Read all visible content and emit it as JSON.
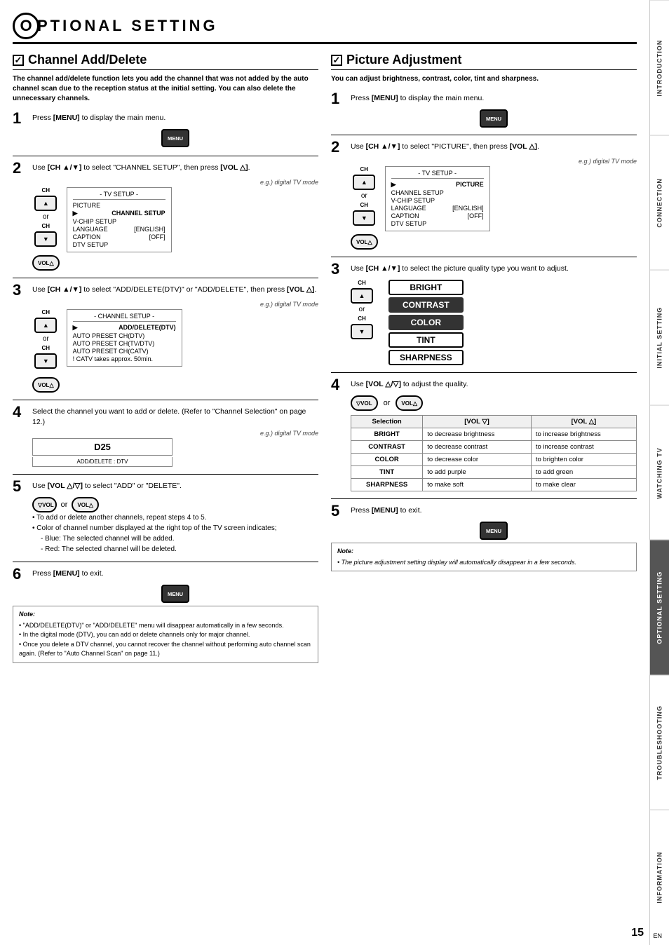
{
  "header": {
    "circle_letter": "O",
    "title": "PTIONAL   SETTING"
  },
  "sidebar_tabs": [
    {
      "label": "INTRODUCTION",
      "active": false
    },
    {
      "label": "CONNECTION",
      "active": false
    },
    {
      "label": "INITIAL SETTING",
      "active": false
    },
    {
      "label": "WATCHING TV",
      "active": false
    },
    {
      "label": "OPTIONAL SETTING",
      "active": true
    },
    {
      "label": "TROUBLESHOOTING",
      "active": false
    },
    {
      "label": "INFORMATION",
      "active": false
    }
  ],
  "channel_section": {
    "heading": "Channel Add/Delete",
    "description": "The channel add/delete function lets you add the channel that was not added by the auto channel scan due to the reception status at the initial setting. You can also delete the unnecessary channels.",
    "steps": [
      {
        "num": "1",
        "text": "Press [MENU] to display the main menu.",
        "has_menu_btn": true
      },
      {
        "num": "2",
        "text": "Use [CH ▲/▼] to select \"CHANNEL SETUP\", then press [VOL △].",
        "eg_label": "e.g.) digital TV mode",
        "tv_setup": {
          "title": "- TV SETUP -",
          "items": [
            "PICTURE",
            "CHANNEL SETUP",
            "V-CHIP  SETUP",
            "LANGUAGE    [ENGLISH]",
            "CAPTION     [OFF]",
            "DTV SETUP"
          ],
          "selected_index": 1
        }
      },
      {
        "num": "3",
        "text": "Use [CH ▲/▼] to select \"ADD/DELETE(DTV)\" or \"ADD/DELETE\", then press [VOL △].",
        "eg_label": "e.g.) digital TV mode",
        "channel_setup": {
          "title": "- CHANNEL SETUP -",
          "items": [
            "ADD/DELETE(DTV)",
            "AUTO PRESET CH(DTV)",
            "AUTO PRESET CH(TV/DTV)",
            "AUTO PRESET CH(CATV)",
            "! CATV takes approx. 50min."
          ],
          "selected_index": 0
        }
      },
      {
        "num": "4",
        "text": "Select the channel you want to add or delete. (Refer to \"Channel Selection\" on page 12.)",
        "eg_label": "e.g.) digital TV mode",
        "d25_label": "D25",
        "add_delete_label": "ADD/DELETE : DTV"
      },
      {
        "num": "5",
        "text": "Use [VOL △/▽] to select \"ADD\" or \"DELETE\".",
        "bullets": [
          "To add or delete another channels, repeat steps 4 to 5.",
          "Color of channel number displayed at the right top of the TV screen indicates;"
        ],
        "indent_bullets": [
          "Blue: The selected channel will be added.",
          "Red: The selected channel will be deleted."
        ]
      },
      {
        "num": "6",
        "text": "Press [MENU] to exit.",
        "has_menu_btn": true,
        "note": {
          "title": "Note:",
          "items": [
            "\"ADD/DELETE(DTV)\" or \"ADD/DELETE\" menu will disappear automatically in a few seconds.",
            "In the digital mode (DTV), you can add or delete channels only for major channel.",
            "Once you delete a DTV channel, you cannot recover the channel without performing auto channel scan again. (Refer to \"Auto Channel Scan\" on page 11.)"
          ]
        }
      }
    ]
  },
  "picture_section": {
    "heading": "Picture Adjustment",
    "description": "You can adjust brightness, contrast, color, tint and sharpness.",
    "steps": [
      {
        "num": "1",
        "text": "Press [MENU] to display the main menu.",
        "has_menu_btn": true
      },
      {
        "num": "2",
        "text": "Use [CH ▲/▼] to select \"PICTURE\", then press [VOL △].",
        "eg_label": "e.g.) digital TV mode",
        "tv_setup": {
          "title": "- TV SETUP -",
          "items": [
            "PICTURE",
            "CHANNEL SETUP",
            "V-CHIP  SETUP",
            "LANGUAGE    [ENGLISH]",
            "CAPTION     [OFF]",
            "DTV SETUP"
          ],
          "selected_index": 0
        }
      },
      {
        "num": "3",
        "text": "Use [CH ▲/▼] to select the picture quality type you want to adjust.",
        "quality_options": [
          "BRIGHT",
          "CONTRAST",
          "COLOR",
          "TINT",
          "SHARPNESS"
        ]
      },
      {
        "num": "4",
        "text": "Use [VOL △/▽] to adjust the quality.",
        "table": {
          "headers": [
            "Selection",
            "[VOL ▽]",
            "[VOL △]"
          ],
          "rows": [
            [
              "BRIGHT",
              "to decrease brightness",
              "to increase brightness"
            ],
            [
              "CONTRAST",
              "to decrease contrast",
              "to increase contrast"
            ],
            [
              "COLOR",
              "to decrease color",
              "to brighten color"
            ],
            [
              "TINT",
              "to add purple",
              "to add green"
            ],
            [
              "SHARPNESS",
              "to make soft",
              "to make clear"
            ]
          ]
        }
      },
      {
        "num": "5",
        "text": "Press [MENU] to exit.",
        "has_menu_btn": true,
        "note": {
          "title": "Note:",
          "items": [
            "The picture adjustment setting display will automatically disappear in a few seconds."
          ]
        }
      }
    ]
  },
  "page_number": "15",
  "en_label": "EN"
}
